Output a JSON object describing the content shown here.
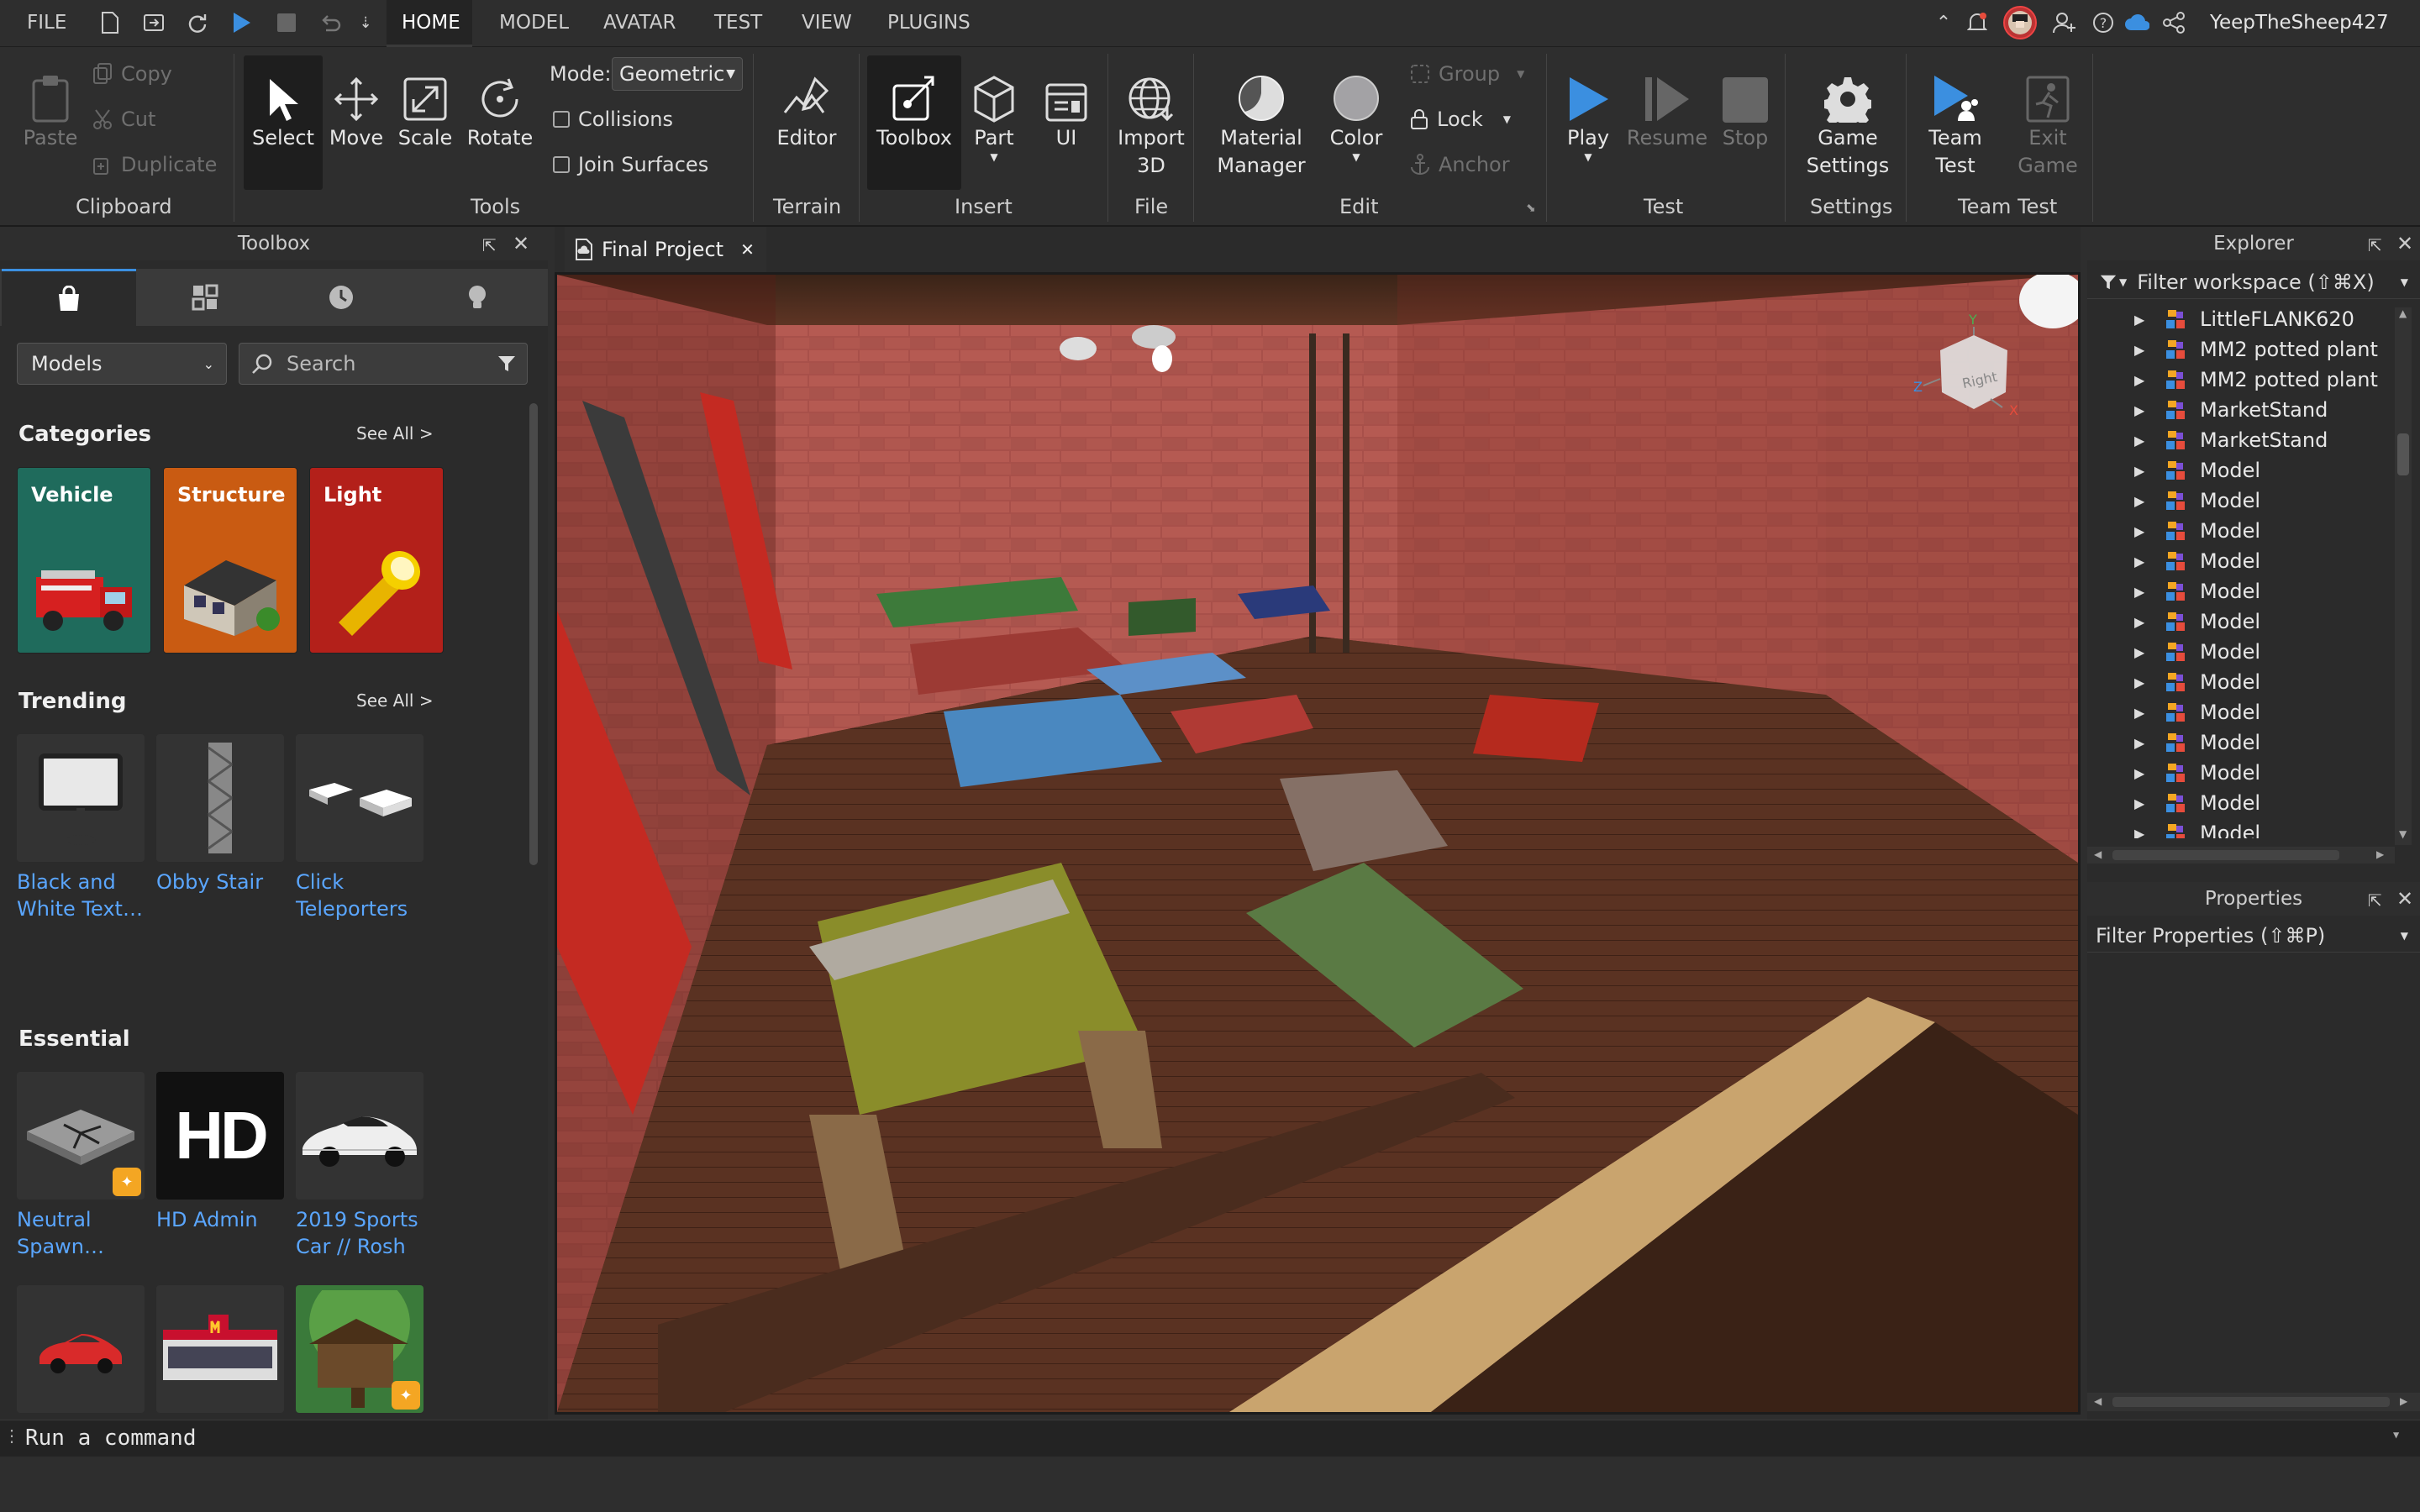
{
  "menu": {
    "file": "FILE",
    "tabs": [
      "HOME",
      "MODEL",
      "AVATAR",
      "TEST",
      "VIEW",
      "PLUGINS"
    ],
    "active_tab": "HOME",
    "username": "YeepTheSheep427"
  },
  "ribbon": {
    "clipboard": {
      "paste": "Paste",
      "copy": "Copy",
      "cut": "Cut",
      "duplicate": "Duplicate",
      "group": "Clipboard"
    },
    "tools": {
      "select": "Select",
      "move": "Move",
      "scale": "Scale",
      "rotate": "Rotate",
      "mode_label": "Mode:",
      "mode_value": "Geometric",
      "collisions": "Collisions",
      "join_surfaces": "Join Surfaces",
      "group": "Tools"
    },
    "terrain": {
      "editor": "Editor",
      "group": "Terrain"
    },
    "insert": {
      "toolbox": "Toolbox",
      "part": "Part",
      "ui": "UI",
      "group": "Insert"
    },
    "file": {
      "import_line1": "Import",
      "import_line2": "3D",
      "group": "File"
    },
    "edit": {
      "material_line1": "Material",
      "material_line2": "Manager",
      "color": "Color",
      "group_btn": "Group",
      "lock": "Lock",
      "anchor": "Anchor",
      "group": "Edit"
    },
    "test": {
      "play": "Play",
      "resume": "Resume",
      "stop": "Stop",
      "group": "Test"
    },
    "settings": {
      "line1": "Game",
      "line2": "Settings",
      "group": "Settings"
    },
    "team_test": {
      "team_line1": "Team",
      "team_line2": "Test",
      "exit_line1": "Exit",
      "exit_line2": "Game",
      "group": "Team Test"
    }
  },
  "toolbox": {
    "title": "Toolbox",
    "category_select": "Models",
    "search_placeholder": "Search",
    "categories_title": "Categories",
    "see_all": "See All >",
    "categories": [
      {
        "label": "Vehicle",
        "color": "#1f6b5c"
      },
      {
        "label": "Structure",
        "color": "#c95b12"
      },
      {
        "label": "Light",
        "color": "#b3201a"
      }
    ],
    "trending_title": "Trending",
    "trending": [
      {
        "name_line1": "Black and",
        "name_line2": "White Text…"
      },
      {
        "name_line1": "Obby Stair",
        "name_line2": ""
      },
      {
        "name_line1": "Click",
        "name_line2": "Teleporters"
      }
    ],
    "essential_title": "Essential",
    "essential": [
      {
        "name_line1": "Neutral",
        "name_line2": "Spawn…"
      },
      {
        "name_line1": "HD Admin",
        "name_line2": "",
        "thumb_text": "HD"
      },
      {
        "name_line1": "2019 Sports",
        "name_line2": "Car // Rosh"
      }
    ]
  },
  "document": {
    "tab_title": "Final Project"
  },
  "viewcube": {
    "face": "Right",
    "y": "Y",
    "z": "Z",
    "x": "X"
  },
  "explorer": {
    "title": "Explorer",
    "filter": "Filter workspace (⇧⌘X)",
    "items": [
      "LittleFLANK620",
      "MM2 potted plant",
      "MM2 potted plant",
      "MarketStand",
      "MarketStand",
      "Model",
      "Model",
      "Model",
      "Model",
      "Model",
      "Model",
      "Model",
      "Model",
      "Model",
      "Model",
      "Model",
      "Model",
      "Model"
    ]
  },
  "properties": {
    "title": "Properties",
    "filter": "Filter Properties (⇧⌘P)"
  },
  "command": {
    "placeholder": "Run a command"
  },
  "colors": {
    "accent": "#3b8fe0",
    "link": "#5aa6ff",
    "panel": "#2b2b2b",
    "ribbon": "#2e2e2e"
  }
}
